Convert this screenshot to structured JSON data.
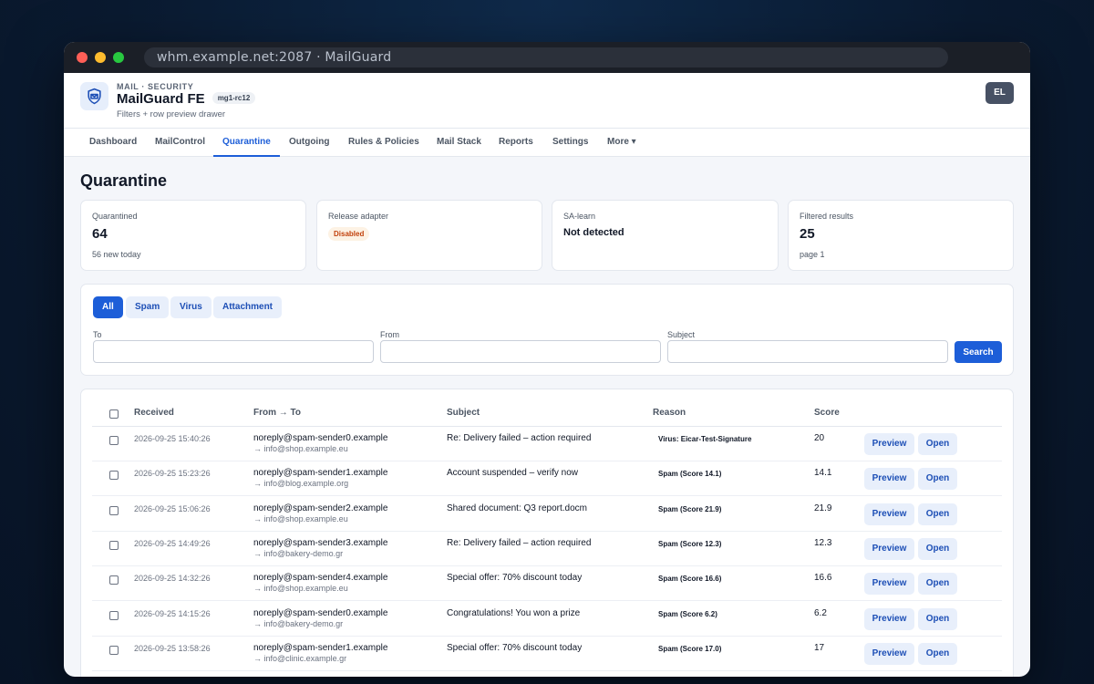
{
  "browser": {
    "url": "whm.example.net:2087 · MailGuard"
  },
  "header": {
    "kicker": "MAIL · SECURITY",
    "title": "MailGuard FE",
    "version": "mg1-rc12",
    "subtitle": "Filters + row preview drawer",
    "avatar": "EL"
  },
  "nav": {
    "items": [
      "Dashboard",
      "MailControl",
      "Quarantine",
      "Outgoing",
      "Rules & Policies",
      "Mail Stack",
      "Reports",
      "Settings",
      "More ▾"
    ],
    "active": "Quarantine"
  },
  "page": {
    "title": "Quarantine"
  },
  "cards": {
    "quarantined": {
      "label": "Quarantined",
      "value": "64",
      "sub": "56 new today"
    },
    "release": {
      "label": "Release adapter",
      "badge": "Disabled"
    },
    "salearn": {
      "label": "SA-learn",
      "value": "Not detected"
    },
    "filtered": {
      "label": "Filtered results",
      "value": "25",
      "sub": "page 1"
    }
  },
  "filters": {
    "chips": [
      "All",
      "Spam",
      "Virus",
      "Attachment"
    ],
    "active_chip": "All",
    "to_label": "To",
    "from_label": "From",
    "subject_label": "Subject",
    "to_value": "",
    "from_value": "",
    "subject_value": "",
    "search_label": "Search"
  },
  "table": {
    "columns": {
      "received": "Received",
      "from_to": "From → To",
      "subject": "Subject",
      "reason": "Reason",
      "score": "Score"
    },
    "preview_label": "Preview",
    "open_label": "Open",
    "rows": [
      {
        "received": "2026-09-25 15:40:26",
        "from": "noreply@spam-sender0.example",
        "to": "→ info@shop.example.eu",
        "subject": "Re: Delivery failed – action required",
        "reason": "Virus: Eicar-Test-Signature",
        "score": "20"
      },
      {
        "received": "2026-09-25 15:23:26",
        "from": "noreply@spam-sender1.example",
        "to": "→ info@blog.example.org",
        "subject": "Account suspended – verify now",
        "reason": "Spam (Score 14.1)",
        "score": "14.1"
      },
      {
        "received": "2026-09-25 15:06:26",
        "from": "noreply@spam-sender2.example",
        "to": "→ info@shop.example.eu",
        "subject": "Shared document: Q3 report.docm",
        "reason": "Spam (Score 21.9)",
        "score": "21.9"
      },
      {
        "received": "2026-09-25 14:49:26",
        "from": "noreply@spam-sender3.example",
        "to": "→ info@bakery-demo.gr",
        "subject": "Re: Delivery failed – action required",
        "reason": "Spam (Score 12.3)",
        "score": "12.3"
      },
      {
        "received": "2026-09-25 14:32:26",
        "from": "noreply@spam-sender4.example",
        "to": "→ info@shop.example.eu",
        "subject": "Special offer: 70% discount today",
        "reason": "Spam (Score 16.6)",
        "score": "16.6"
      },
      {
        "received": "2026-09-25 14:15:26",
        "from": "noreply@spam-sender0.example",
        "to": "→ info@bakery-demo.gr",
        "subject": "Congratulations! You won a prize",
        "reason": "Spam (Score 6.2)",
        "score": "6.2"
      },
      {
        "received": "2026-09-25 13:58:26",
        "from": "noreply@spam-sender1.example",
        "to": "→ info@clinic.example.gr",
        "subject": "Special offer: 70% discount today",
        "reason": "Spam (Score 17.0)",
        "score": "17"
      }
    ]
  }
}
